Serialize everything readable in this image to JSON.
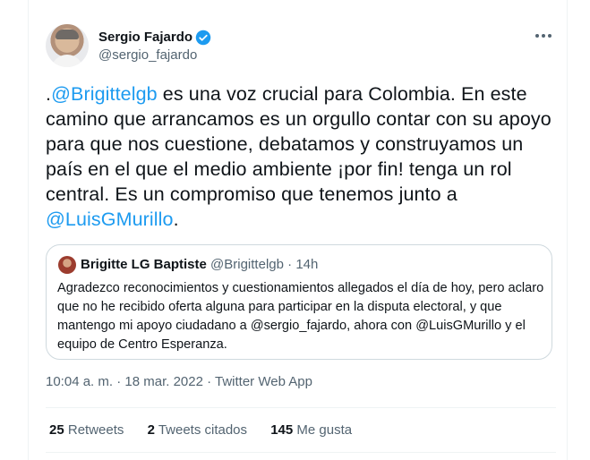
{
  "author": {
    "name": "Sergio Fajardo",
    "handle": "@sergio_fajardo",
    "verified_icon": "verified-badge-icon"
  },
  "tweet": {
    "prefix": ".",
    "mention1": "@Brigittelgb",
    "text1": " es una voz crucial para Colombia. En este camino que arrancamos es un orgullo contar con su apoyo para que nos cuestione, debatamos y construyamos un país en el que el medio ambiente ¡por fin! tenga un rol central. Es un compromiso que tenemos junto a ",
    "mention2": "@LuisGMurillo",
    "suffix": "."
  },
  "quote": {
    "name": "Brigitte LG Baptiste",
    "handle": "@Brigittelgb",
    "separator": "·",
    "time": "14h",
    "text": "Agradezco reconocimientos y cuestionamientos allegados el día de hoy, pero aclaro que no he recibido oferta alguna para participar en la disputa electoral, y que mantengo mi apoyo ciudadano a @sergio_fajardo, ahora con @LuisGMurillo y el equipo de Centro Esperanza."
  },
  "timestamp": "10:04 a. m. · 18 mar. 2022 · Twitter Web App",
  "stats": {
    "retweets_count": "25",
    "retweets_label": "Retweets",
    "quotes_count": "2",
    "quotes_label": "Tweets citados",
    "likes_count": "145",
    "likes_label": "Me gusta"
  },
  "colors": {
    "accent": "#1d9bf0",
    "text": "#0f1419",
    "secondary": "#536471",
    "border": "#cfd9de"
  }
}
